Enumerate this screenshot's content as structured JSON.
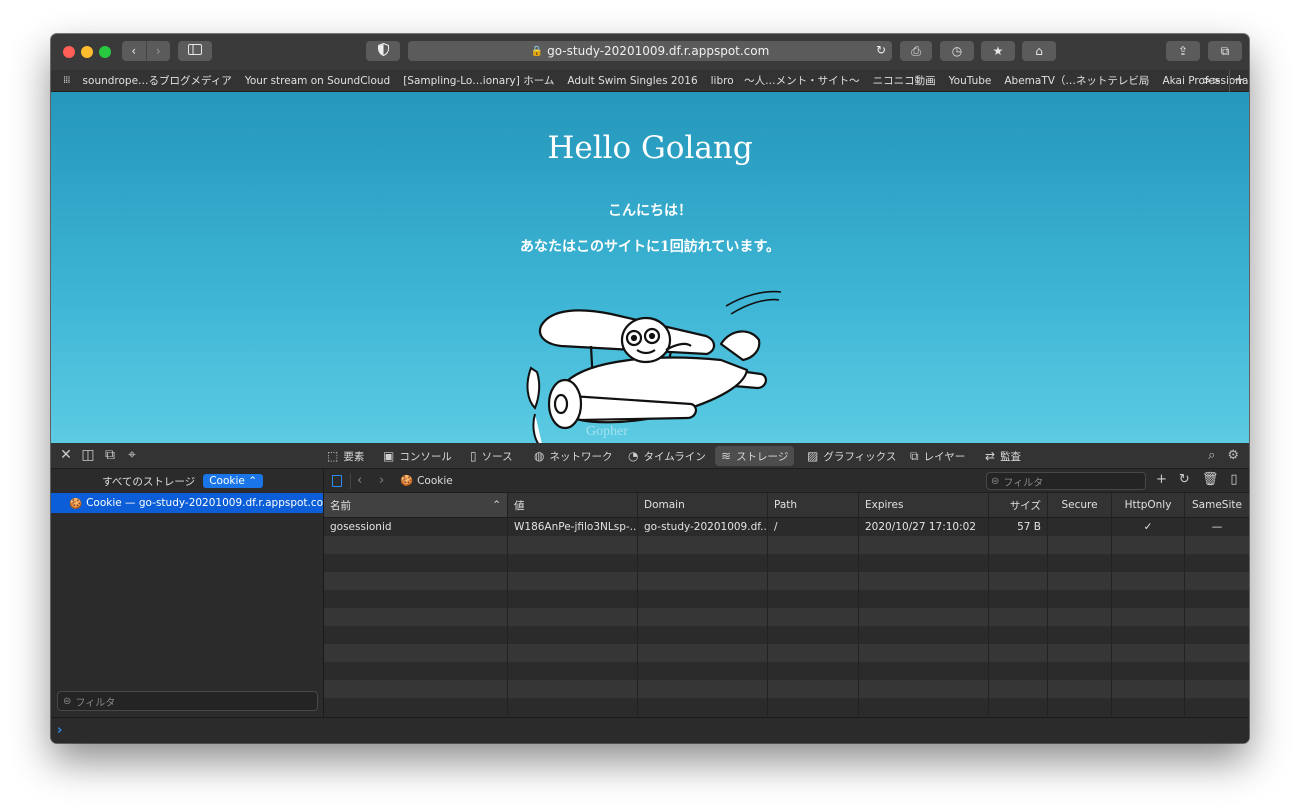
{
  "browser": {
    "url": "go-study-20201009.df.r.appspot.com",
    "icons": {
      "back": "chevron-left-icon",
      "forward": "chevron-right-icon",
      "sidebar": "sidebar-icon",
      "shield": "shield-icon",
      "lock": "lock-icon",
      "reload": "reload-icon",
      "print": "printer-icon",
      "history": "clock-icon",
      "bookmark": "bookmark-star-icon",
      "home": "home-icon",
      "share": "share-icon",
      "tabs": "tabs-overview-icon"
    }
  },
  "bookmarks": {
    "items": [
      "soundrope…るブログメディア",
      "Your stream on SoundCloud",
      "[Sampling-Lo…ionary] ホーム",
      "Adult Swim Singles 2016",
      "libro　〜人…メント・サイト〜",
      "ニコニコ動画",
      "YouTube",
      "AbemaTV（…ネットテレビ局",
      "Akai Professional"
    ],
    "more": ">>",
    "add": "+"
  },
  "page": {
    "title": "Hello Golang",
    "greeting": "こんにちは！",
    "visits": "あなたはこのサイトに1回訪れています。",
    "credit": "Gopher",
    "background_top": "#2497bb",
    "background_bottom": "#5ccbe3"
  },
  "devtools": {
    "tabs": [
      {
        "icon": "elements-icon",
        "glyph": "⬚",
        "label": "要素"
      },
      {
        "icon": "console-icon",
        "glyph": "▣",
        "label": "コンソール"
      },
      {
        "icon": "sources-icon",
        "glyph": "▯",
        "label": "ソース"
      },
      {
        "icon": "network-icon",
        "glyph": "◍",
        "label": "ネットワーク"
      },
      {
        "icon": "timeline-icon",
        "glyph": "◔",
        "label": "タイムライン"
      },
      {
        "icon": "storage-icon",
        "glyph": "≋",
        "label": "ストレージ"
      },
      {
        "icon": "graphics-icon",
        "glyph": "▨",
        "label": "グラフィックス"
      },
      {
        "icon": "layers-icon",
        "glyph": "⧉",
        "label": "レイヤー"
      },
      {
        "icon": "audit-icon",
        "glyph": "⇄",
        "label": "監査"
      }
    ],
    "active_tab": "ストレージ",
    "sidebar": {
      "header": "すべてのストレージ",
      "select_value": "Cookie",
      "selected_item": "Cookie — go-study-20201009.df.r.appspot.com",
      "filter_placeholder": "フィルタ"
    },
    "main": {
      "breadcrumb": "Cookie",
      "filter_placeholder": "フィルタ",
      "columns": [
        "名前",
        "値",
        "Domain",
        "Path",
        "Expires",
        "サイズ",
        "Secure",
        "HttpOnly",
        "SameSite"
      ],
      "rows": [
        {
          "name": "gosessionid",
          "value": "W186AnPe-jfilo3NLsp-...",
          "domain": "go-study-20201009.df...",
          "path": "/",
          "expires": "2020/10/27 17:10:02",
          "size": "57 B",
          "secure": "",
          "httponly": "✓",
          "samesite": "—"
        }
      ]
    },
    "accent": "#1a76e8"
  }
}
